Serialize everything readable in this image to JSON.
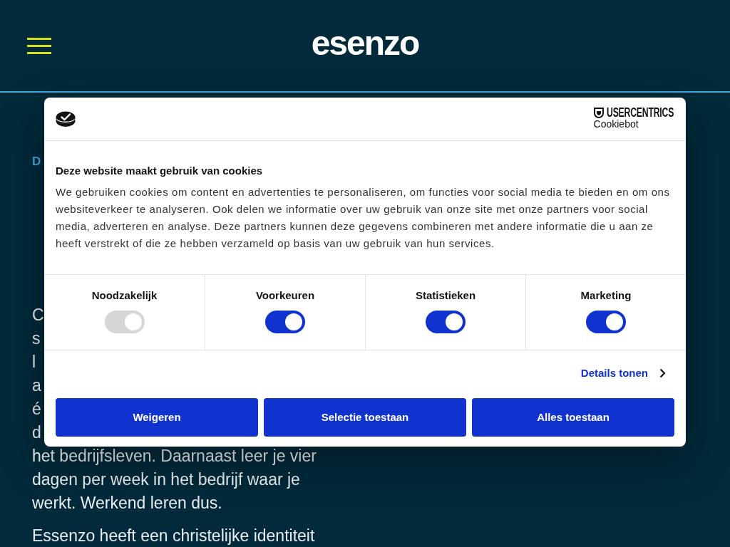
{
  "header": {
    "logo": "esenzo"
  },
  "page": {
    "label": "D",
    "paragraph_lines": [
      "C",
      "s",
      "l",
      "a",
      "é",
      "d",
      "het bedrijfsleven. Daarnaast leer je vier",
      "dagen per week in het bedrijf waar je",
      "werkt. Werkend leren dus."
    ],
    "paragraph_2": "Essenzo heeft een christelijke identiteit"
  },
  "cookie_dialog": {
    "brand": {
      "name": "USERCENTRICS",
      "product": "Cookiebot"
    },
    "title": "Deze website maakt gebruik van cookies",
    "text": "We gebruiken cookies om content en advertenties te personaliseren, om functies voor social media te bieden en om ons websiteverkeer te analyseren. Ook delen we informatie over uw gebruik van onze site met onze partners voor social media, adverteren en analyse. Deze partners kunnen deze gegevens combineren met andere informatie die u aan ze heeft verstrekt of die ze hebben verzameld op basis van uw gebruik van hun services.",
    "categories": [
      {
        "label": "Noodzakelijk",
        "checked": true,
        "disabled": true
      },
      {
        "label": "Voorkeuren",
        "checked": true,
        "disabled": false
      },
      {
        "label": "Statistieken",
        "checked": true,
        "disabled": false
      },
      {
        "label": "Marketing",
        "checked": true,
        "disabled": false
      }
    ],
    "details_link": "Details tonen",
    "buttons": [
      "Weigeren",
      "Selectie toestaan",
      "Alles toestaan"
    ]
  }
}
